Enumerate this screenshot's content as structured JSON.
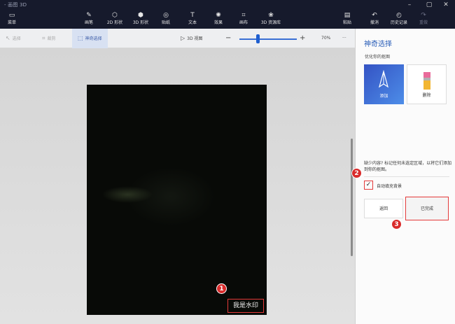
{
  "window": {
    "title": "- 画图 3D"
  },
  "toolbar": {
    "menu": "菜单",
    "tools": [
      {
        "label": "画笔",
        "icon": "brush-icon",
        "glyph": "✎"
      },
      {
        "label": "2D 形状",
        "icon": "2d-shapes-icon",
        "glyph": "⬡"
      },
      {
        "label": "3D 形状",
        "icon": "3d-shapes-icon",
        "glyph": "⬢"
      },
      {
        "label": "贴纸",
        "icon": "stickers-icon",
        "glyph": "◎"
      },
      {
        "label": "文本",
        "icon": "text-icon",
        "glyph": "T"
      },
      {
        "label": "效果",
        "icon": "effects-icon",
        "glyph": "✺"
      },
      {
        "label": "画布",
        "icon": "canvas-icon",
        "glyph": "⌗"
      },
      {
        "label": "3D 资源库",
        "icon": "3d-library-icon",
        "glyph": "❀"
      }
    ],
    "paste": "粘贴",
    "undo": "撤消",
    "history": "历史记录",
    "redo": "重做"
  },
  "subbar": {
    "select": "选择",
    "crop": "裁剪",
    "magic_select": "神奇选择",
    "view_3d": "3D 视图",
    "zoom": "70%",
    "more": "···"
  },
  "canvas": {
    "watermark": "我是水印"
  },
  "panel": {
    "title": "神奇选择",
    "subtitle": "优化你的抠图",
    "add": "添加",
    "remove": "删除",
    "hint": "缺少内容? 标记任何未选定区域，以将它们添加到你的抠图。",
    "autofill": "自动填充背景",
    "autofill_checked": true,
    "back": "返回",
    "done": "已完成"
  },
  "annotations": {
    "one": "1",
    "two": "2",
    "three": "3"
  },
  "colors": {
    "accent": "#2a5eb8",
    "highlight": "#e43a3a",
    "titlebar": "#161a2c"
  }
}
